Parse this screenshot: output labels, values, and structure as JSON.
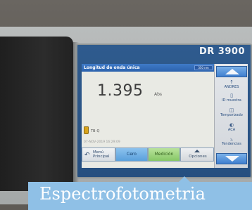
{
  "device": {
    "model": "DR 3900"
  },
  "screen": {
    "mode_title": "Longitud de onda única",
    "wavelength": "350 nm",
    "reading": "1.395",
    "unit": "Abs",
    "sample_id": "TB-Q",
    "timestamp": "07-NOV-2019 16:29:09"
  },
  "side_panel": {
    "items": [
      {
        "icon": "arrow-up-icon",
        "label": "ANDRES"
      },
      {
        "icon": "sample-id-icon",
        "label": "ID muestra"
      },
      {
        "icon": "timer-icon",
        "label": "Temporizado"
      },
      {
        "icon": "aca-icon",
        "label": "ACA"
      },
      {
        "icon": "trend-icon",
        "label": "Tendencias"
      }
    ]
  },
  "softkeys": {
    "menu": "Menú Principal",
    "zero": "Cero",
    "measure": "Medición",
    "options": "Opciones"
  },
  "caption": {
    "text": "Espectrofotometria"
  }
}
